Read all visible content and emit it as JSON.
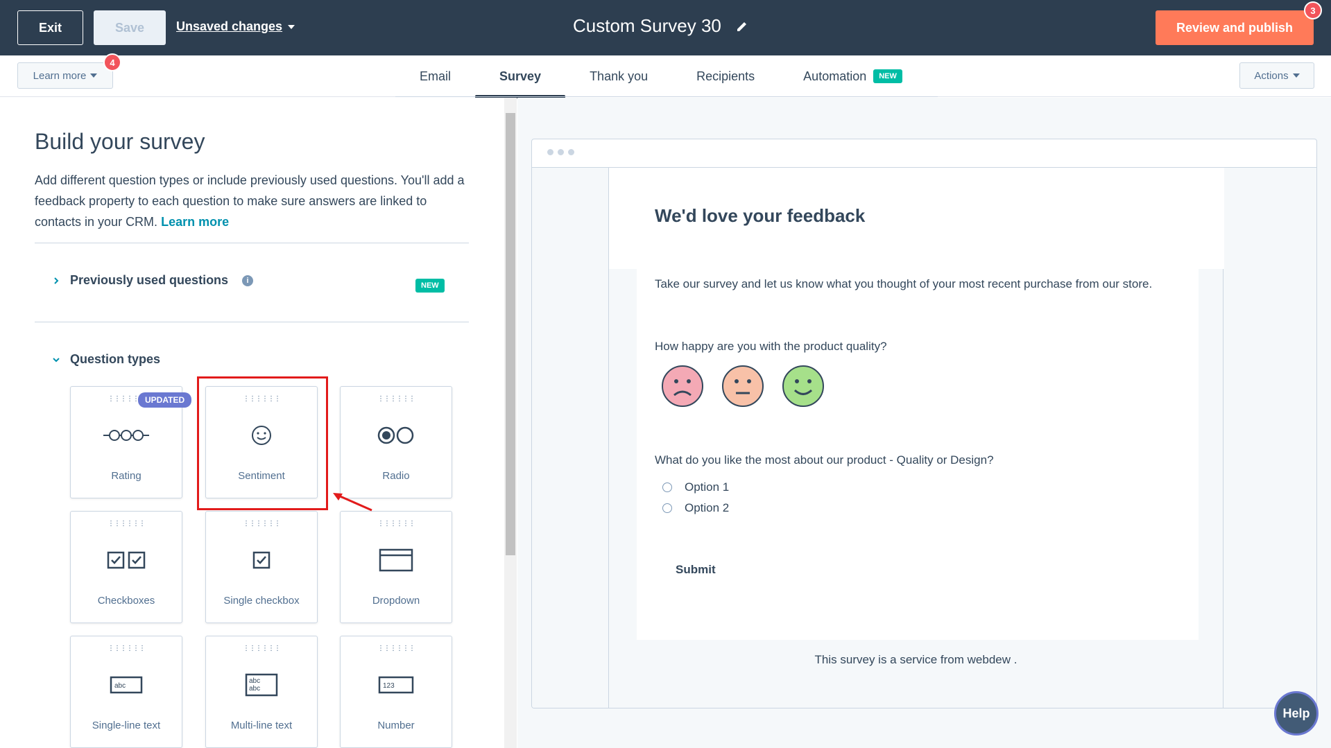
{
  "header": {
    "exit_label": "Exit",
    "save_label": "Save",
    "unsaved_label": "Unsaved changes",
    "title": "Custom Survey 30",
    "review_label": "Review and publish",
    "review_badge": "3"
  },
  "tabbar": {
    "learn_label": "Learn more",
    "learn_badge": "4",
    "actions_label": "Actions",
    "tabs": [
      {
        "label": "Email"
      },
      {
        "label": "Survey"
      },
      {
        "label": "Thank you"
      },
      {
        "label": "Recipients"
      },
      {
        "label": "Automation",
        "badge": "NEW"
      }
    ]
  },
  "builder": {
    "title": "Build your survey",
    "desc": "Add different question types or include previously used questions. You'll add a feedback property to each question to make sure answers are linked to contacts in your CRM.",
    "desc_link": "Learn more",
    "previous_label": "Previously used questions",
    "previous_badge": "NEW",
    "types_label": "Question types",
    "updated_badge": "UPDATED",
    "cards": [
      {
        "label": "Rating",
        "icon": "rating-icon"
      },
      {
        "label": "Sentiment",
        "icon": "smiley-icon"
      },
      {
        "label": "Radio",
        "icon": "radio-icon"
      },
      {
        "label": "Checkboxes",
        "icon": "checkboxes-icon"
      },
      {
        "label": "Single checkbox",
        "icon": "checkbox-icon"
      },
      {
        "label": "Dropdown",
        "icon": "dropdown-icon"
      },
      {
        "label": "Single-line text",
        "icon": "single-line-text-icon",
        "icon_text": "abc"
      },
      {
        "label": "Multi-line text",
        "icon": "multi-line-text-icon",
        "icon_text": "abc"
      },
      {
        "label": "Number",
        "icon": "number-icon",
        "icon_text": "123"
      }
    ]
  },
  "preview": {
    "title": "We'd love your feedback",
    "intro": "Take our survey and let us know what you thought of your most recent purchase from our store.",
    "q1": "How happy are you with the product quality?",
    "q2": "What do you like the most about our product - Quality or Design?",
    "options": [
      "Option 1",
      "Option 2"
    ],
    "submit": "Submit",
    "service": "This survey is a service from webdew ."
  },
  "help_label": "Help",
  "colors": {
    "accent": "#ff7a59",
    "nav": "#2d3e50",
    "teal": "#00bda5",
    "highlight": "#e21b1b"
  }
}
